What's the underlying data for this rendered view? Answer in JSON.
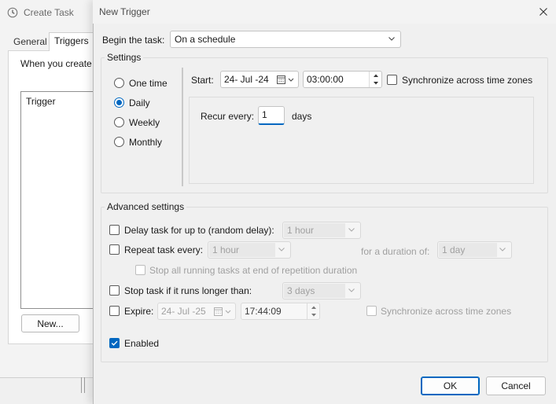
{
  "background_window": {
    "title": "Create Task",
    "tabs": [
      "General",
      "Triggers"
    ],
    "active_tab": "Triggers",
    "description_text": "When you create",
    "list_header": "Trigger",
    "new_button_label": "New..."
  },
  "dialog": {
    "title": "New Trigger",
    "begin_task": {
      "label": "Begin the task:",
      "value": "On a schedule"
    },
    "settings": {
      "title": "Settings",
      "schedule_options": [
        "One time",
        "Daily",
        "Weekly",
        "Monthly"
      ],
      "selected_option": "Daily",
      "start_label": "Start:",
      "start_date": "24- Jul -24",
      "start_time": "03:00:00",
      "sync_label": "Synchronize across time zones",
      "sync_checked": false,
      "recur_label": "Recur every:",
      "recur_value": "1",
      "recur_unit": "days"
    },
    "advanced": {
      "title": "Advanced settings",
      "delay": {
        "label": "Delay task for up to (random delay):",
        "value": "1 hour",
        "checked": false
      },
      "repeat": {
        "label": "Repeat task every:",
        "value": "1 hour",
        "checked": false,
        "duration_label": "for a duration of:",
        "duration_value": "1 day"
      },
      "stop_all": {
        "label": "Stop all running tasks at end of repetition duration",
        "checked": false
      },
      "stop_if_longer": {
        "label": "Stop task if it runs longer than:",
        "value": "3 days",
        "checked": false
      },
      "expire": {
        "label": "Expire:",
        "date": "24- Jul -25",
        "time": "17:44:09",
        "checked": false,
        "sync_label": "Synchronize across time zones"
      },
      "enabled": {
        "label": "Enabled",
        "checked": true
      }
    },
    "buttons": {
      "ok": "OK",
      "cancel": "Cancel"
    }
  },
  "colors": {
    "accent": "#0067c0",
    "dialog_bg": "#f0f0f0",
    "disabled_text": "#a0a0a0"
  },
  "icons": [
    "clock-icon",
    "close-icon",
    "chevron-down-icon",
    "calendar-icon",
    "spin-up-icon",
    "spin-down-icon",
    "checkmark-icon"
  ]
}
